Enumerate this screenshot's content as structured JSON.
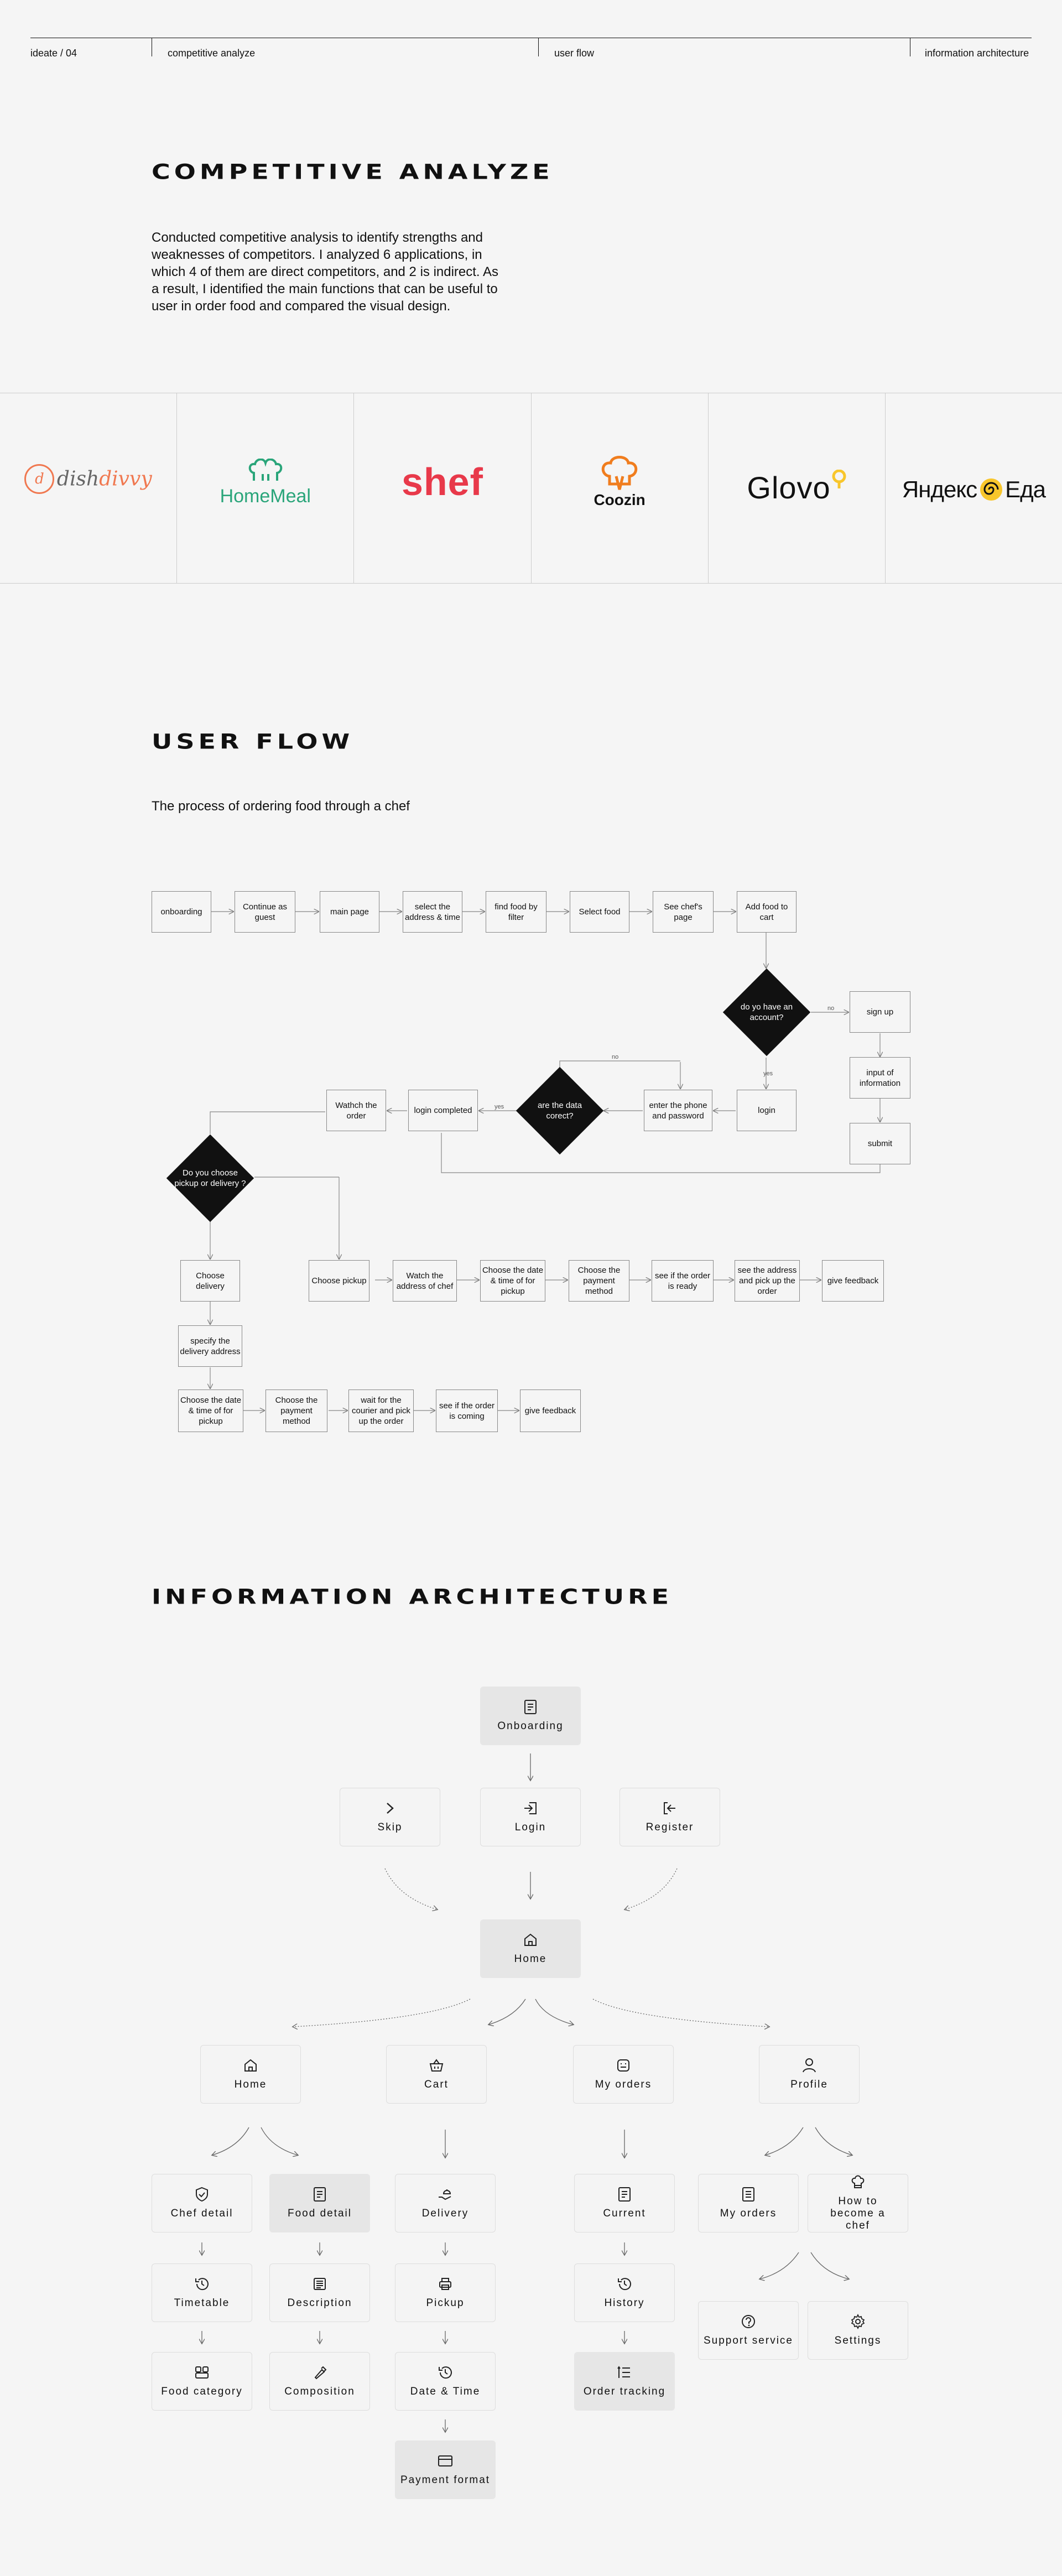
{
  "nav": {
    "left": "ideate / 04",
    "item1": "competitive analyze",
    "item2": "user flow",
    "item3": "information architecture"
  },
  "competitive": {
    "title": "competitive analyze",
    "description": "Conducted competitive analysis to identify strengths and weaknesses of competitors. I analyzed 6 applications, in which 4 of them are direct competitors, and 2 is indirect. As a result, I identified the main functions that can be useful to user in order food and compared the visual design.",
    "logos": {
      "dishdivvy_a": "dish",
      "dishdivvy_b": "divvy",
      "homemeal": "HomeMeal",
      "shef": "shef",
      "coozin": "Coozin",
      "glovo": "Glovo",
      "yandex_a": "Яндекс",
      "yandex_b": "Еда"
    },
    "colors": {
      "dishdivvy": "#f07850",
      "homemeal": "#2aa57a",
      "shef": "#e8394a",
      "coozin": "#f07d1e",
      "glovo_dot": "#f8c62c",
      "yandex": "#f8c62c"
    }
  },
  "userflow": {
    "title": "user flow",
    "subtitle": "The process of ordering food through a chef",
    "boxes": {
      "onboarding": "onboarding",
      "guest": "Continue as guest",
      "main": "main page",
      "address": "select the address & time",
      "filter": "find food by filter",
      "select_food": "Select food",
      "chef_page": "See chef's page",
      "add_cart": "Add food to cart",
      "signup": "sign up",
      "input_info": "input of information",
      "submit": "submit",
      "login": "login",
      "enter_phone": "enter the phone and password",
      "login_completed": "login completed",
      "watch_order": "Wathch the order",
      "choose_delivery": "Choose delivery",
      "specify_address": "specify the delivery address",
      "d_datetime": "Choose the date & time of for pickup",
      "d_payment": "Choose the payment method",
      "d_wait": "wait for the courier and pick up the order",
      "d_coming": "see if the order is coming",
      "d_feedback": "give feedback",
      "choose_pickup": "Choose pickup",
      "p_chef_addr": "Watch the address of chef",
      "p_datetime": "Choose the date & time of for pickup",
      "p_payment": "Choose the payment method",
      "p_ready": "see if the order is ready",
      "p_see_addr": "see the address and pick up the order",
      "p_feedback": "give feedback"
    },
    "decisions": {
      "account": "do yo have an account?",
      "correct": "are the data corect?",
      "pickup_or_delivery": "Do you choose pickup or delivery ?"
    },
    "edge_labels": {
      "no1": "no",
      "yes1": "yes",
      "no2": "no",
      "yes2": "yes"
    }
  },
  "ia": {
    "title": "information architecture",
    "onboarding": "Onboarding",
    "skip": "Skip",
    "login": "Login",
    "register": "Register",
    "home_top": "Home",
    "home": "Home",
    "cart": "Cart",
    "my_orders": "My orders",
    "profile": "Profile",
    "chef_detail": "Chef detail",
    "food_detail": "Food detail",
    "timetable": "Timetable",
    "description": "Description",
    "food_category": "Food category",
    "composition": "Composition",
    "delivery": "Delivery",
    "pickup": "Pickup",
    "date_time": "Date & Time",
    "payment_format": "Payment format",
    "current": "Current",
    "history": "History",
    "order_tracking": "Order tracking",
    "p_orders": "My orders",
    "become_chef": "How to become a chef",
    "support": "Support service",
    "settings": "Settings"
  }
}
